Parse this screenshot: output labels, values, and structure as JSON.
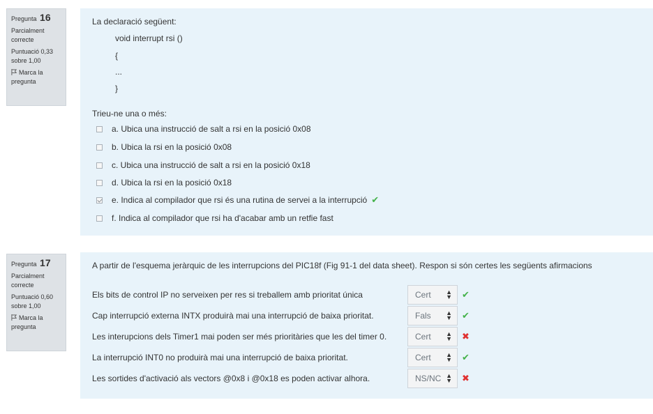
{
  "q16": {
    "label": "Pregunta",
    "number": "16",
    "state": "Parcialment correcte",
    "grade": "Puntuació 0,33 sobre 1,00",
    "flag": "Marca la pregunta",
    "intro": "La declaració següent:",
    "code": [
      "void interrupt rsi ()",
      "{",
      "...",
      "}"
    ],
    "prompt": "Trieu-ne una o més:",
    "options": [
      {
        "text": "a. Ubica una instrucció de salt a rsi en la posició 0x08",
        "checked": false
      },
      {
        "text": "b. Ubica la rsi en la posició 0x08",
        "checked": false
      },
      {
        "text": "c. Ubica una instrucció de salt a rsi en la posició 0x18",
        "checked": false
      },
      {
        "text": "d. Ubica la rsi en la posició 0x18",
        "checked": false
      },
      {
        "text": "e. Indica al compilador que rsi és una rutina de servei a la interrupció",
        "checked": true
      },
      {
        "text": "f. Indica al compilador que rsi ha d'acabar amb un retfie fast",
        "checked": false
      }
    ],
    "mark_correct": "✔"
  },
  "q17": {
    "label": "Pregunta",
    "number": "17",
    "state": "Parcialment correcte",
    "grade": "Puntuació 0,60 sobre 1,00",
    "flag": "Marca la pregunta",
    "intro": "A partir de l'esquema jeràrquic de les interrupcions del PIC18f (Fig 91-1 del data sheet). Respon si són certes les següents afirmacions",
    "rows": [
      {
        "text": "Els bits de control IP no serveixen per res si treballem amb prioritat única",
        "value": "Cert",
        "mark": "✔"
      },
      {
        "text": "Cap interrupció externa INTX produirà mai una interrupció de baixa prioritat.",
        "value": "Fals",
        "mark": "✔"
      },
      {
        "text": "Les interupcions dels Timer1 mai poden ser més prioritàries que les del timer 0.",
        "value": "Cert",
        "mark": "✖"
      },
      {
        "text": "La interrupció INT0 no produirà mai una interrupció de baixa prioritat.",
        "value": "Cert",
        "mark": "✔"
      },
      {
        "text": "Les sortides d'activació als vectors @0x8 i @0x18 es poden activar alhora.",
        "value": "NS/NC",
        "mark": "✖"
      }
    ]
  },
  "icons": {
    "flag": "flag-icon",
    "check": "check-icon",
    "cross": "cross-icon",
    "select_arrows": "sort-arrows-icon"
  },
  "colors": {
    "info_bg": "#dee2e6",
    "content_bg": "#e8f3fa",
    "correct": "#44b24a",
    "incorrect": "#e03131"
  }
}
